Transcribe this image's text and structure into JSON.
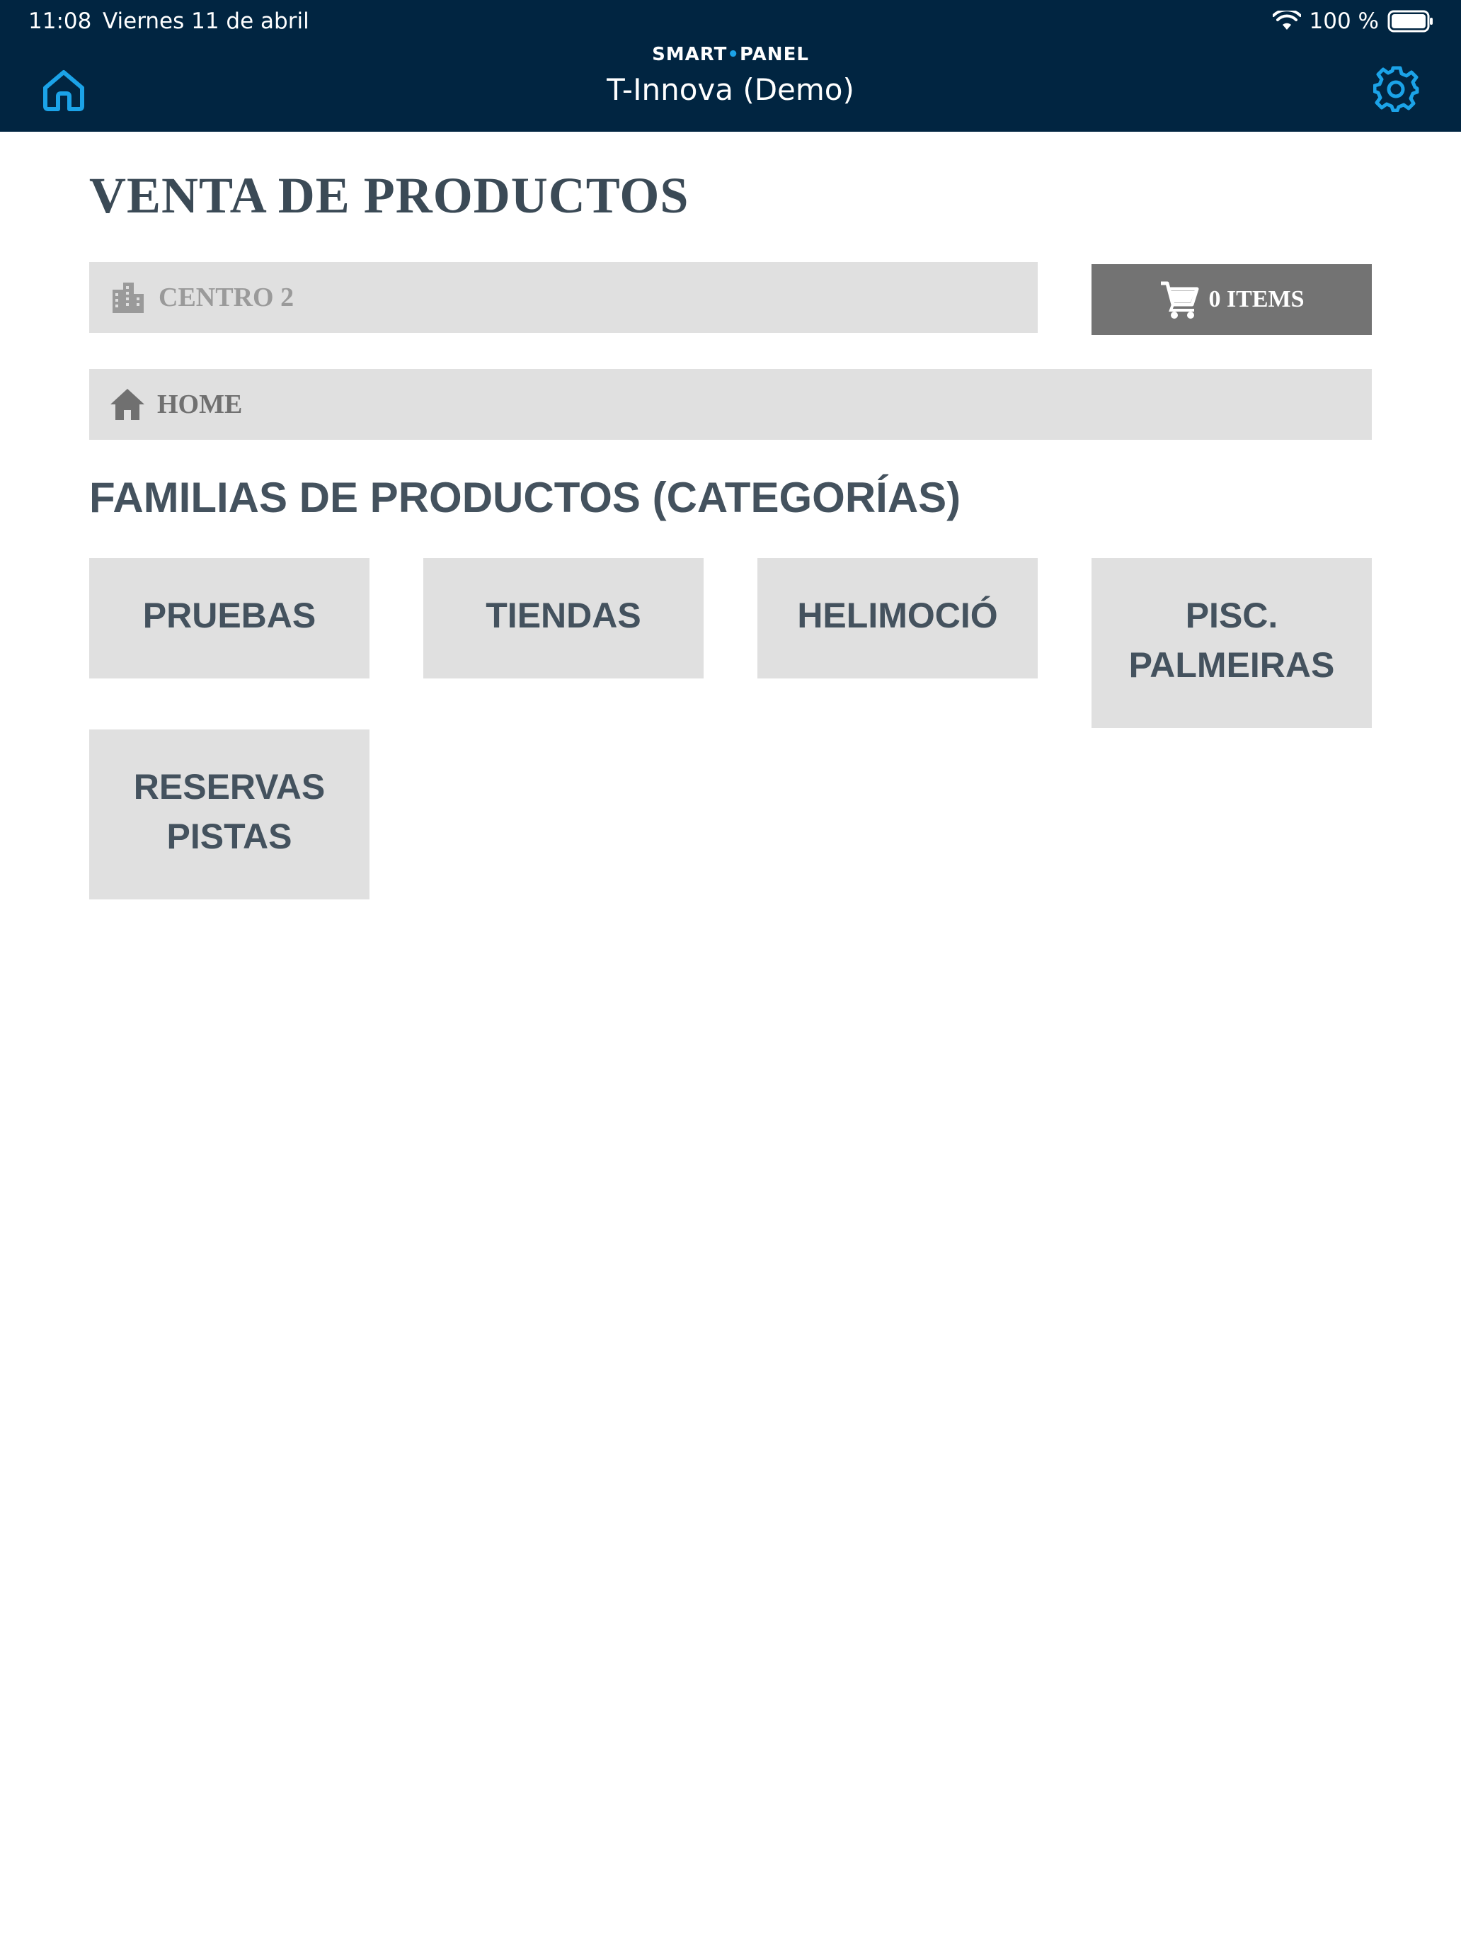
{
  "status_bar": {
    "time": "11:08",
    "date": "Viernes 11 de abril",
    "battery": "100 %"
  },
  "header": {
    "brand_left": "SMART",
    "brand_dot": "•",
    "brand_right": "PANEL",
    "title": "T-Innova (Demo)"
  },
  "page": {
    "title": "VENTA DE PRODUCTOS",
    "center": "CENTRO 2",
    "cart_label": "0 ITEMS",
    "breadcrumb": "HOME",
    "section_title": "FAMILIAS DE PRODUCTOS (CATEGORÍAS)"
  },
  "categories": [
    {
      "label": "PRUEBAS"
    },
    {
      "label": "TIENDAS"
    },
    {
      "label": "HELIMOCIÓ"
    },
    {
      "label": "PISC. PALMEIRAS"
    },
    {
      "label": "RESERVAS PISTAS"
    }
  ],
  "colors": {
    "header_bg": "#012541",
    "accent": "#1ba3e8",
    "tile_bg": "#e0e0e0",
    "cart_bg": "#737373",
    "heading_text": "#44525e"
  },
  "icons": {
    "home": "home-outline-icon",
    "settings": "gear-icon",
    "center": "building-icon",
    "cart": "cart-icon",
    "breadcrumb": "home-icon",
    "wifi": "wifi-icon",
    "battery": "battery-icon"
  }
}
